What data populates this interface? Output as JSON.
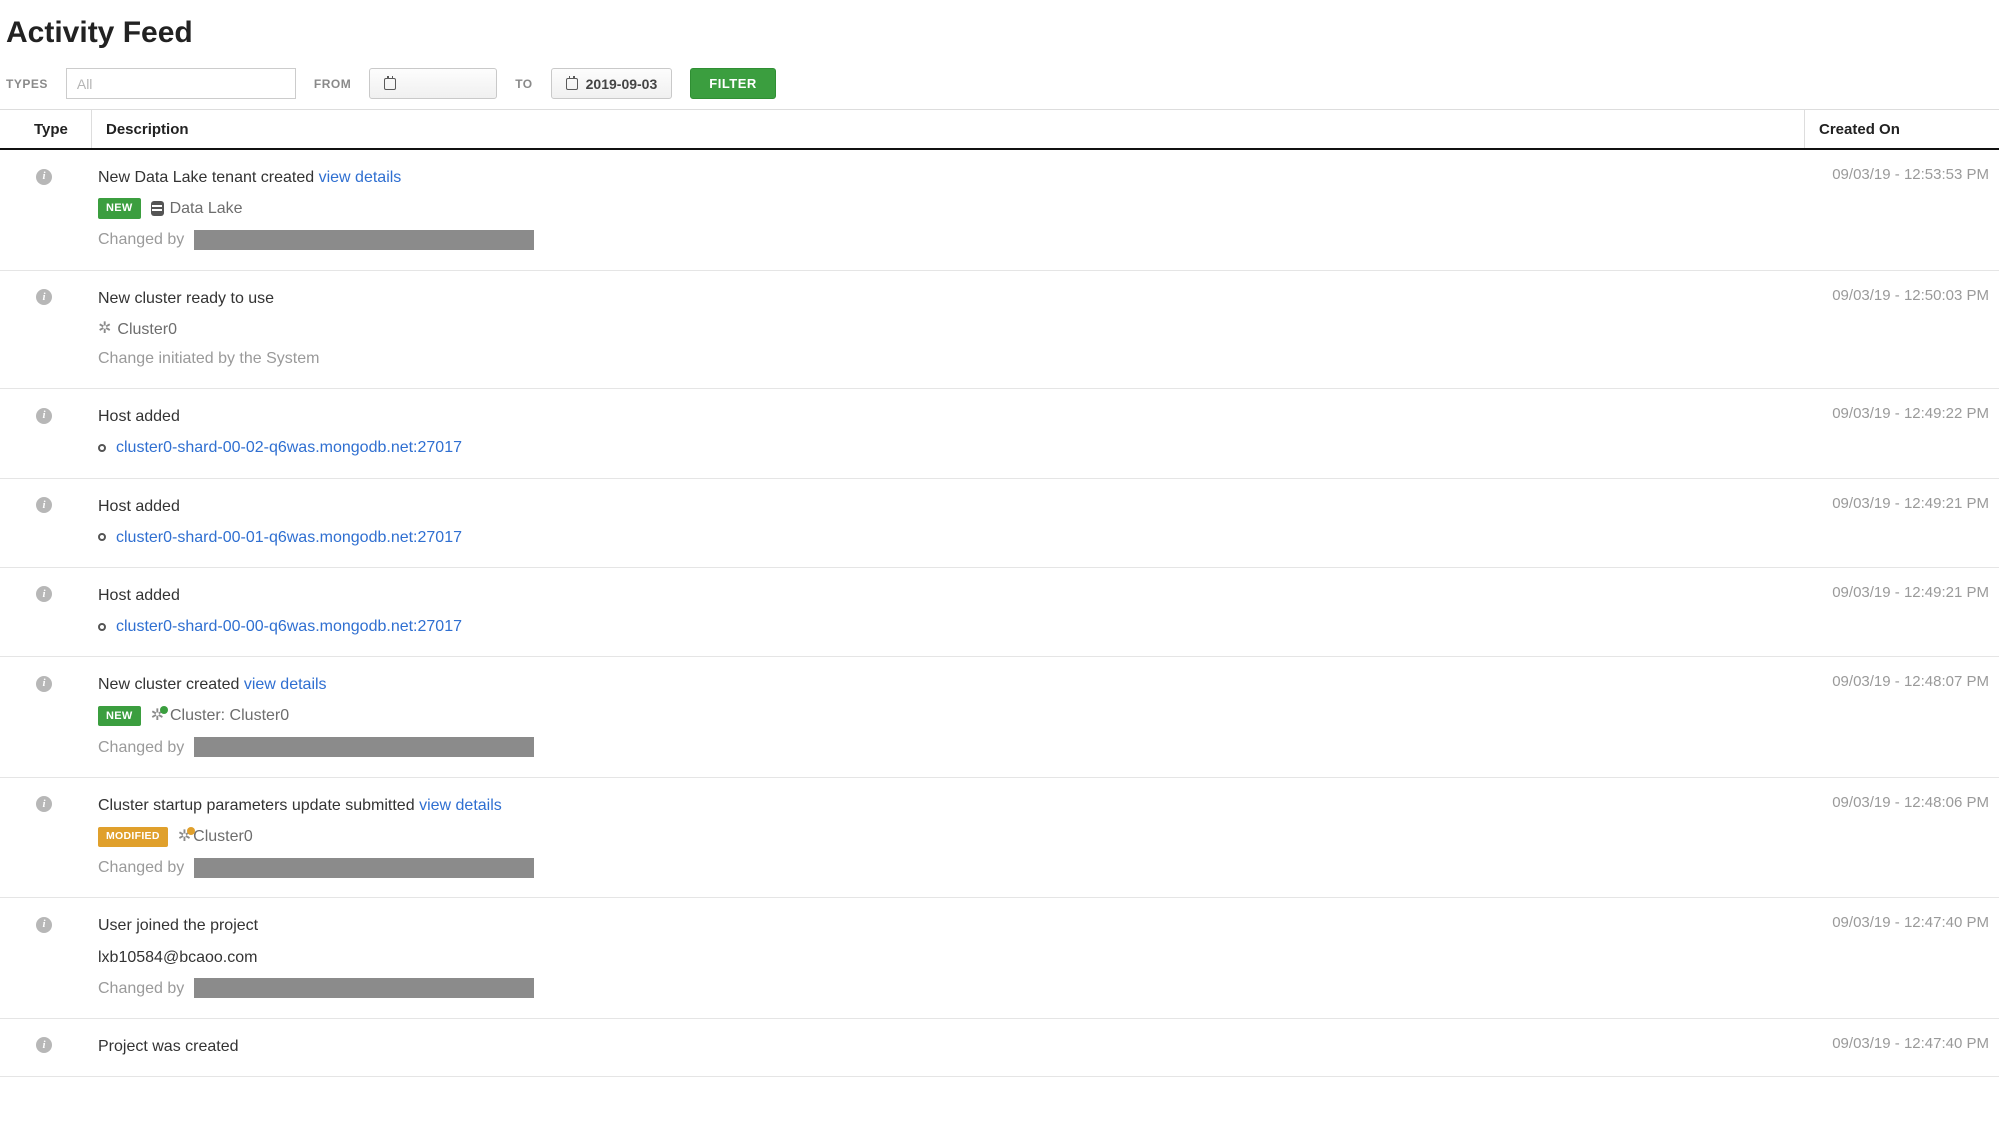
{
  "header": {
    "title": "Activity Feed"
  },
  "filters": {
    "types_label": "TYPES",
    "types_placeholder": "All",
    "from_label": "FROM",
    "to_label": "TO",
    "to_date": "2019-09-03",
    "filter_button": "FILTER"
  },
  "columns": {
    "type": "Type",
    "description": "Description",
    "created": "Created On"
  },
  "common": {
    "changed_by": "Changed by",
    "system_change": "Change initiated by the System",
    "view_details": "view details"
  },
  "badges": {
    "new": "NEW",
    "modified": "MODIFIED"
  },
  "feed": [
    {
      "title": "New Data Lake tenant created",
      "has_view_details": true,
      "badge": "new",
      "entity_icon": "db",
      "entity": "Data Lake",
      "changed_by_redacted": true,
      "created": "09/03/19 - 12:53:53 PM"
    },
    {
      "title": "New cluster ready to use",
      "entity_icon": "gear",
      "entity": "Cluster0",
      "system_change": true,
      "created": "09/03/19 - 12:50:03 PM"
    },
    {
      "title": "Host added",
      "host_link": "cluster0-shard-00-02-q6was.mongodb.net:27017",
      "created": "09/03/19 - 12:49:22 PM"
    },
    {
      "title": "Host added",
      "host_link": "cluster0-shard-00-01-q6was.mongodb.net:27017",
      "created": "09/03/19 - 12:49:21 PM"
    },
    {
      "title": "Host added",
      "host_link": "cluster0-shard-00-00-q6was.mongodb.net:27017",
      "created": "09/03/19 - 12:49:21 PM"
    },
    {
      "title": "New cluster created",
      "has_view_details": true,
      "badge": "new",
      "entity_icon": "gear-badged-green",
      "entity": "Cluster: Cluster0",
      "changed_by_redacted": true,
      "created": "09/03/19 - 12:48:07 PM"
    },
    {
      "title": "Cluster startup parameters update submitted",
      "has_view_details": true,
      "badge": "modified",
      "entity_icon": "gear-badged",
      "entity": "Cluster0",
      "entity_tight": true,
      "changed_by_redacted": true,
      "created": "09/03/19 - 12:48:06 PM"
    },
    {
      "title": "User joined the project",
      "subtext": "lxb10584@bcaoo.com",
      "changed_by_redacted": true,
      "created": "09/03/19 - 12:47:40 PM"
    },
    {
      "title": "Project was created",
      "created": "09/03/19 - 12:47:40 PM"
    }
  ]
}
